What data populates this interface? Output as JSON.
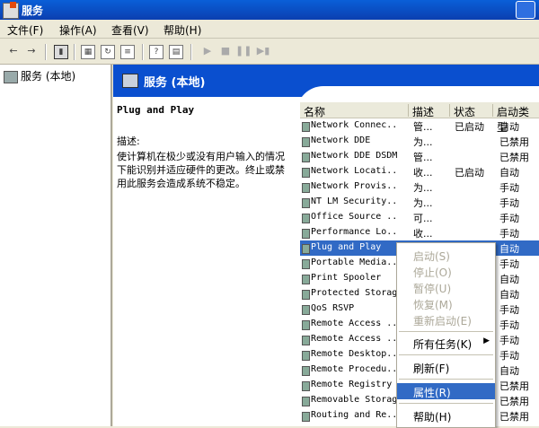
{
  "window": {
    "title": "服务"
  },
  "menu": [
    "文件(F)",
    "操作(A)",
    "查看(V)",
    "帮助(H)"
  ],
  "tree": {
    "root": "服务 (本地)"
  },
  "panel": {
    "title": "服务 (本地)",
    "selected_name": "Plug and Play",
    "desc_label": "描述:",
    "desc_text": "使计算机在极少或没有用户输入的情况下能识别并适应硬件的更改。终止或禁用此服务会造成系统不稳定。"
  },
  "columns": {
    "name": "名称",
    "desc": "描述",
    "status": "状态",
    "startup": "启动类型"
  },
  "services": [
    {
      "name": "Network Connec...",
      "desc": "管...",
      "status": "已启动",
      "startup": "自动"
    },
    {
      "name": "Network DDE",
      "desc": "为...",
      "status": "",
      "startup": "已禁用"
    },
    {
      "name": "Network DDE DSDM",
      "desc": "管...",
      "status": "",
      "startup": "已禁用"
    },
    {
      "name": "Network Locati...",
      "desc": "收...",
      "status": "已启动",
      "startup": "自动"
    },
    {
      "name": "Network Provis...",
      "desc": "为...",
      "status": "",
      "startup": "手动"
    },
    {
      "name": "NT LM Security...",
      "desc": "为...",
      "status": "",
      "startup": "手动"
    },
    {
      "name": "Office Source ...",
      "desc": "可...",
      "status": "",
      "startup": "手动"
    },
    {
      "name": "Performance Lo...",
      "desc": "收...",
      "status": "",
      "startup": "手动"
    },
    {
      "name": "Plug and Play",
      "desc": "",
      "status": "",
      "startup": "自动"
    },
    {
      "name": "Portable Media...",
      "desc": "",
      "status": "",
      "startup": "手动"
    },
    {
      "name": "Print Spooler",
      "desc": "",
      "status": "",
      "startup": "自动"
    },
    {
      "name": "Protected Storag",
      "desc": "",
      "status": "",
      "startup": "自动"
    },
    {
      "name": "QoS RSVP",
      "desc": "",
      "status": "",
      "startup": "手动"
    },
    {
      "name": "Remote Access ...",
      "desc": "",
      "status": "",
      "startup": "手动"
    },
    {
      "name": "Remote Access ...",
      "desc": "",
      "status": "",
      "startup": "手动"
    },
    {
      "name": "Remote Desktop...",
      "desc": "",
      "status": "",
      "startup": "手动"
    },
    {
      "name": "Remote Procedu...",
      "desc": "",
      "status": "",
      "startup": "自动"
    },
    {
      "name": "Remote Registry",
      "desc": "",
      "status": "",
      "startup": "已禁用"
    },
    {
      "name": "Removable Storag",
      "desc": "",
      "status": "",
      "startup": "已禁用"
    },
    {
      "name": "Routing and Re...",
      "desc": "",
      "status": "",
      "startup": "已禁用"
    }
  ],
  "context_menu": {
    "start": "启动(S)",
    "stop": "停止(O)",
    "pause": "暂停(U)",
    "resume": "恢复(M)",
    "restart": "重新启动(E)",
    "all_tasks": "所有任务(K)",
    "refresh": "刷新(F)",
    "properties": "属性(R)",
    "help": "帮助(H)"
  }
}
